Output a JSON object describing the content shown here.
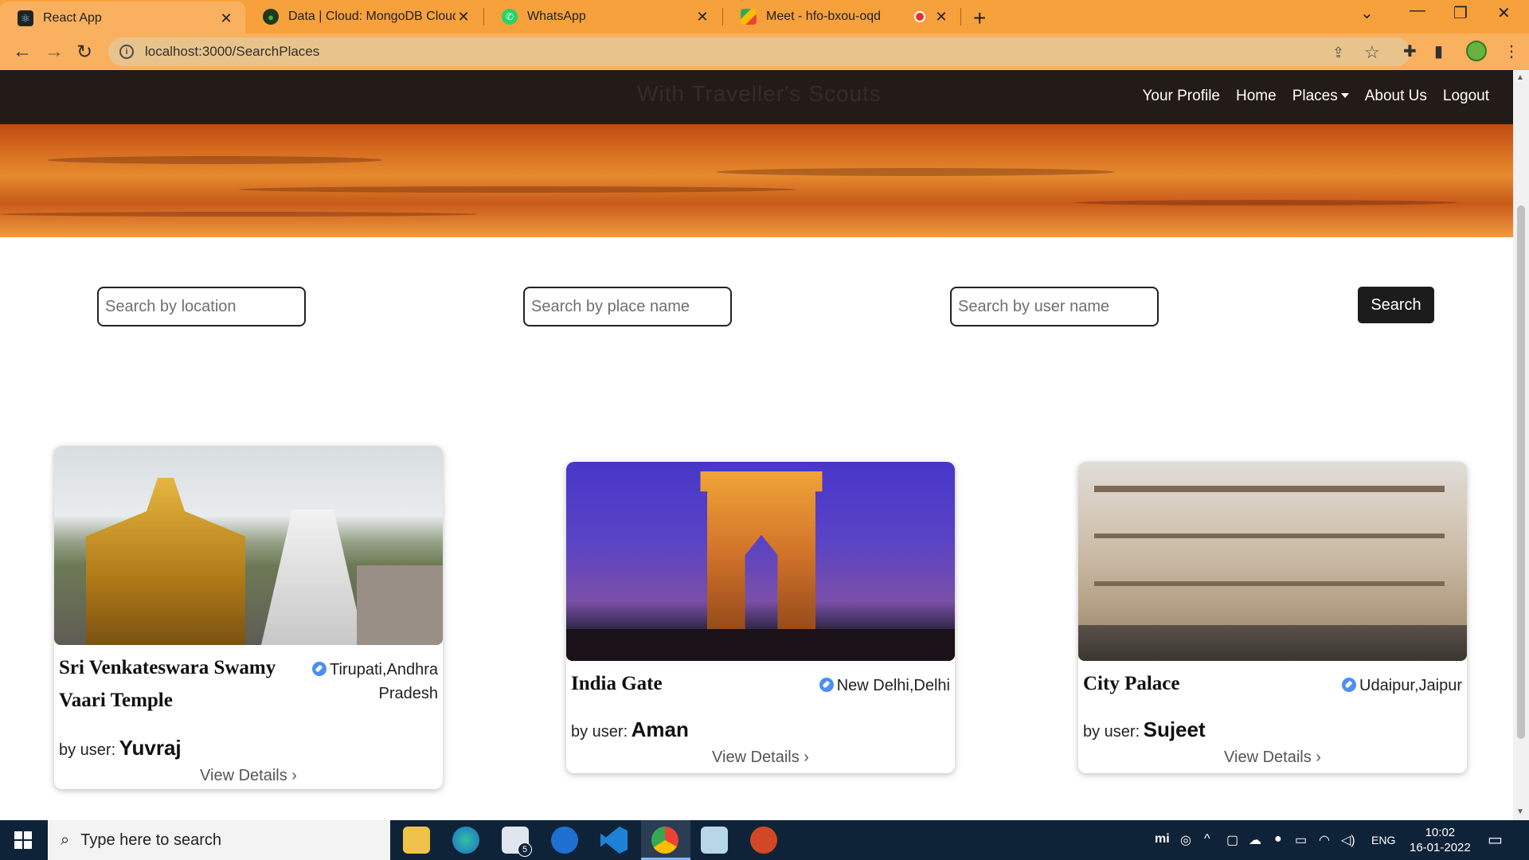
{
  "browser": {
    "tabs": [
      {
        "title": "React App",
        "active": true,
        "icon": "react-icon"
      },
      {
        "title": "Data | Cloud: MongoDB Cloud",
        "active": false,
        "icon": "mongodb-icon"
      },
      {
        "title": "WhatsApp",
        "active": false,
        "icon": "whatsapp-icon"
      },
      {
        "title": "Meet - hfo-bxou-oqd",
        "active": false,
        "icon": "meet-icon"
      }
    ],
    "url": "localhost:3000/SearchPlaces"
  },
  "navbar": {
    "brand": "With Traveller's Scouts",
    "links": [
      "Your Profile",
      "Home",
      "Places",
      "About Us",
      "Logout"
    ]
  },
  "search": {
    "location_placeholder": "Search by location",
    "place_placeholder": "Search by place name",
    "user_placeholder": "Search by user name",
    "button_label": "Search"
  },
  "cards": [
    {
      "name": "Sri Venkateswara Swamy Vaari Temple",
      "location_line1": "Tirupati,Andhra",
      "location_line2": "Pradesh",
      "by_label": "by user:",
      "user": "Yuvraj",
      "view": "View Details"
    },
    {
      "name": "India Gate",
      "location_line1": "New Delhi,Delhi",
      "by_label": "by user:",
      "user": "Aman",
      "view": "View Details"
    },
    {
      "name": "City Palace",
      "location_line1": "Udaipur,Jaipur",
      "by_label": "by user:",
      "user": "Sujeet",
      "view": "View Details"
    }
  ],
  "taskbar": {
    "search_placeholder": "Type here to search",
    "lang": "ENG",
    "time": "10:02",
    "date": "16-01-2022",
    "mail_badge": "5"
  },
  "colors": {
    "tabstrip": "#f7a13c",
    "navbar": "#231b18",
    "taskbar": "#0f2338"
  }
}
